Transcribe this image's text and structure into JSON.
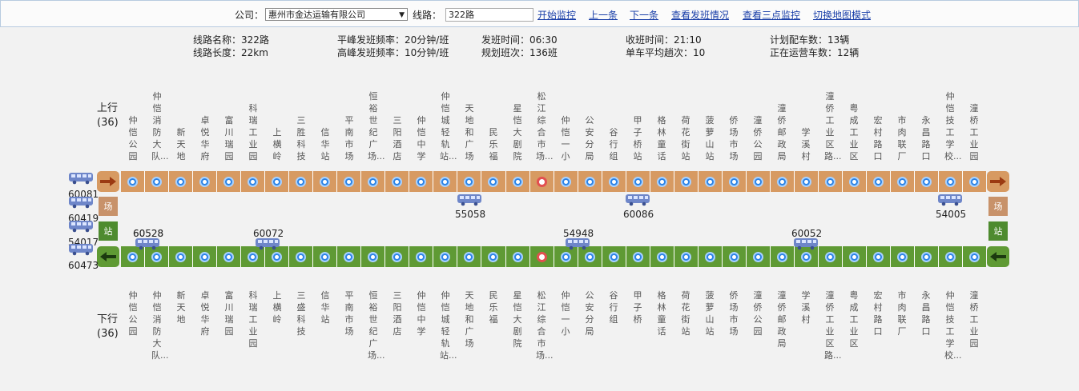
{
  "toolbar": {
    "company_label": "公司：",
    "company_value": "惠州市金达运输有限公司",
    "line_label": "线路：",
    "line_value": "322路",
    "links": [
      "开始监控",
      "上一条",
      "下一条",
      "查看发班情况",
      "查看三点监控",
      "切换地图模式"
    ]
  },
  "info": {
    "line_name": "线路名称：322路",
    "line_length": "线路长度：22km",
    "offpeak_freq": "平峰发班频率：20分钟/班",
    "peak_freq": "高峰发班频率：10分钟/班",
    "first_bus": "发班时间：06:30",
    "planned_trips": "规划班次：136班",
    "last_bus": "收班时间：21:10",
    "avg_trips": "单车平均趟次：10",
    "planned_vehicles": "计划配车数：13辆",
    "running_vehicles": "正在运营车数：12辆"
  },
  "direction": {
    "up_label": "上行",
    "up_count": "(36)",
    "down_label": "下行",
    "down_count": "(36)"
  },
  "stations_up": [
    "仲恺公园",
    "仲恺消防大队...",
    "新天地",
    "卓悦华府",
    "富川瑞园",
    "科瑞工业园",
    "上横岭",
    "三胜科技",
    "信华站",
    "平南市场",
    "恒裕世纪广场...",
    "三阳酒店",
    "仲恺中学",
    "仲恺城轻轨站...",
    "天地和广场",
    "民乐福",
    "星恺大剧院",
    "松江综合市场...",
    "仲恺一小",
    "公安分局",
    "谷行组",
    "甲子桥站",
    "格林童话",
    "荷花街站",
    "菠萝山站",
    "侨场市场",
    "潼侨公园",
    "潼侨邮政局",
    "学溪村",
    "潼侨工业区路...",
    "粤成工业区",
    "宏村路口",
    "市肉联厂",
    "永昌路口",
    "仲恺技工学校...",
    "潼桥工业园"
  ],
  "stations_down": [
    "仲恺公园",
    "仲恺消防大队...",
    "新天地",
    "卓悦华府",
    "富川瑞园",
    "科瑞工业园",
    "上横岭",
    "三盛科技",
    "信华站",
    "平南市场",
    "恒裕世纪广场...",
    "三阳酒店",
    "仲恺中学",
    "仲恺城轻轨站...",
    "天地和广场",
    "民乐福",
    "星恺大剧院",
    "松江综合市场...",
    "仲恺一小",
    "公安分局",
    "谷行组",
    "甲子桥",
    "格林童话",
    "荷花街站",
    "菠萝山站",
    "侨场市场",
    "潼侨公园",
    "潼侨邮政局",
    "学溪村",
    "潼侨工业区路...",
    "粤成工业区",
    "宏村路口",
    "市肉联厂",
    "永昌路口",
    "仲恺技工学校...",
    "潼桥工业园"
  ],
  "highlight_station": "松江综合市场...",
  "depot_buses": [
    "60081",
    "60419",
    "54017",
    "60473"
  ],
  "up_buses": [
    "55058",
    "60086",
    "54005"
  ],
  "down_buses": [
    "60528",
    "60072",
    "54948",
    "60052"
  ],
  "down_buses_overlap": "60528",
  "side_tags": [
    "场",
    "站",
    "场",
    "站"
  ],
  "colors": {
    "up_bar": "#d79a62",
    "down_bar": "#5f9a34",
    "arrow_up": "#9b3a12",
    "arrow_down": "#1c3a10",
    "bus": "#6e86c9",
    "link": "#1a3fa8"
  },
  "icons": {
    "up_arrow": "arrow-right-icon",
    "down_arrow": "arrow-left-icon",
    "bus": "bus-icon",
    "station": "station-dot-icon"
  }
}
